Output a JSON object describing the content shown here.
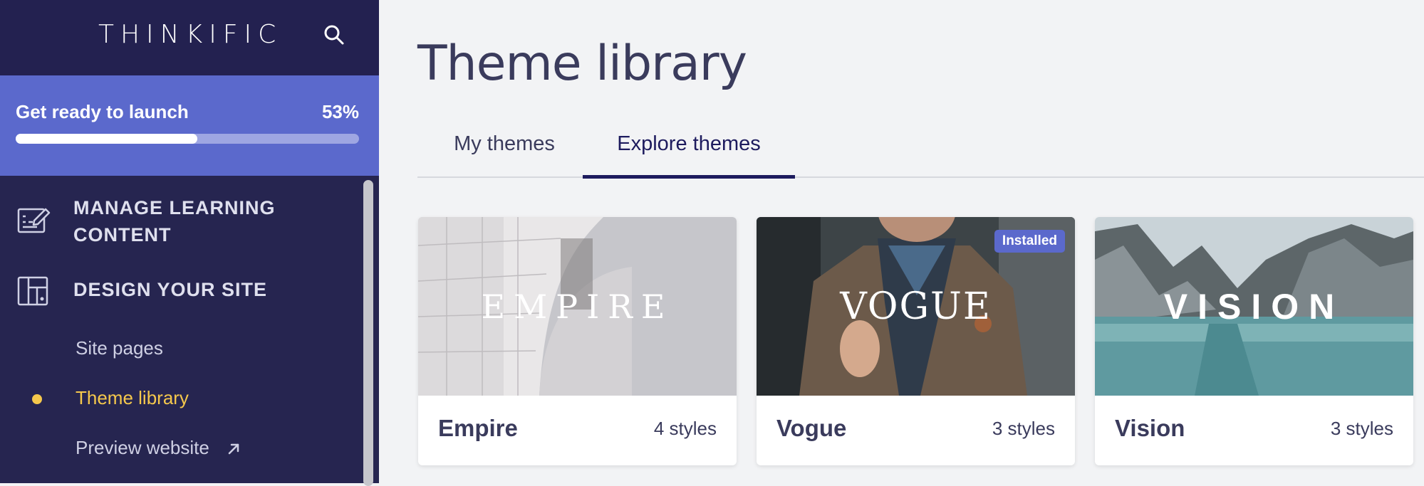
{
  "app": {
    "logo_text": "THINKIFIC"
  },
  "launch": {
    "title": "Get ready to launch",
    "percent_label": "53%",
    "progress": 0.53
  },
  "sidebar": {
    "sections": [
      {
        "label_line1": "MANAGE LEARNING",
        "label_line2": "CONTENT",
        "icon": "edit-content-icon"
      },
      {
        "label_line1": "DESIGN YOUR SITE",
        "icon": "layout-icon"
      }
    ],
    "sub_items": [
      {
        "label": "Site pages"
      },
      {
        "label": "Theme library",
        "active": true
      },
      {
        "label": "Preview website",
        "icon": "external-link-icon"
      }
    ]
  },
  "main": {
    "title": "Theme library",
    "tabs": [
      {
        "label": "My themes"
      },
      {
        "label": "Explore themes",
        "active": true
      }
    ]
  },
  "themes": [
    {
      "name": "Empire",
      "styles": "4 styles",
      "thumb_text": "EMPIRE"
    },
    {
      "name": "Vogue",
      "styles": "3 styles",
      "thumb_text": "VOGUE",
      "badge": "Installed"
    },
    {
      "name": "Vision",
      "styles": "3 styles",
      "thumb_text": "VISION"
    }
  ],
  "colors": {
    "sidebar": "#262550",
    "accent": "#5b69cc",
    "active_item": "#f5c84c",
    "text_dark": "#3a3b5c"
  }
}
